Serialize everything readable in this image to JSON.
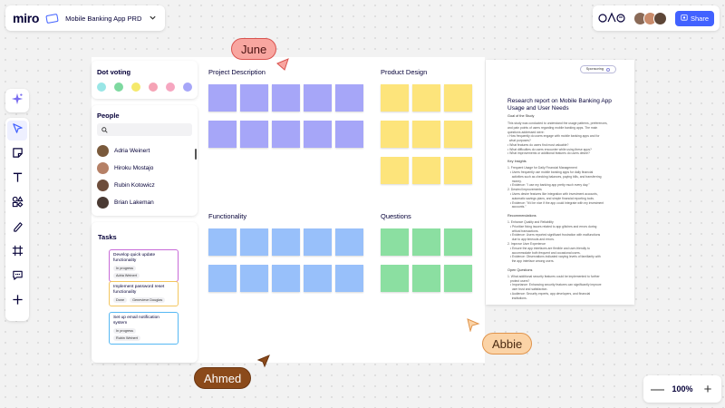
{
  "app": {
    "logo": "miro",
    "board_title": "Mobile Banking App PRD"
  },
  "header": {
    "reactions_label": "♪ ☺ ✈",
    "share_label": "Share",
    "avatar_colors": [
      "#8a6a57",
      "#c98b6b",
      "#5d4637"
    ]
  },
  "toolbar": {
    "tools": [
      "select-cursor",
      "sticky-note",
      "text",
      "shapes",
      "pen",
      "frame",
      "comment",
      "add-more"
    ]
  },
  "zoom": {
    "minus": "—",
    "level": "100%",
    "plus": "+"
  },
  "dot_voting": {
    "title": "Dot voting",
    "colors": [
      "#99e6e6",
      "#7ed9a0",
      "#f5e96b",
      "#f5a3b5",
      "#f6a6c0",
      "#a6a6f8"
    ]
  },
  "people": {
    "title": "People",
    "members": [
      {
        "name": "Adria Weinert",
        "color": "#7a5a3c"
      },
      {
        "name": "Hiroku Mostajo",
        "color": "#b58066"
      },
      {
        "name": "Rubin Kotowicz",
        "color": "#6d4d3b"
      },
      {
        "name": "Brian Lakeman",
        "color": "#4a3a33"
      }
    ]
  },
  "tasks": {
    "title": "Tasks",
    "items": [
      {
        "title": "Develop quick update functionality",
        "status": "In progress",
        "assignee": "Adria Weinert",
        "border": "#c86bd8"
      },
      {
        "title": "Implement password reset functionality",
        "status": "Done",
        "assignee": "Genevieve Douglas",
        "border": "#f3c65f"
      },
      {
        "title": "Set up email notification system",
        "status": "In progress",
        "assignee": "Rubin Weinert",
        "border": "#56b8f3"
      }
    ]
  },
  "frames": {
    "project_description": "Project Description",
    "product_design": "Product Design",
    "functionality": "Functionality",
    "questions": "Questions"
  },
  "document": {
    "tag": "Sponsoring",
    "title": "Research report on Mobile Banking App Usage and User Needs",
    "goal_heading": "Goal of the Study",
    "goal_lines": [
      "This study was conducted to understand the usage patterns, preferences,",
      "and pain points of users regarding mobile banking apps. The main",
      "questions addressed were:",
      "• How frequently do users engage with mobile banking apps and for",
      "  what purposes?",
      "• What features do users find most valuable?",
      "• What difficulties do users encounter while using these apps?",
      "• What improvements or additional features do users desire?"
    ],
    "insights_heading": "Key Insights",
    "insights_lines": [
      "1. Frequent Usage for Daily Financial Management",
      "   • Users frequently use mobile banking apps for daily financial",
      "     activities such as checking balances, paying bills, and transferring",
      "     money.",
      "   • Evidence: \"I use my banking app pretty much every day.\"",
      "2. Desired Improvements",
      "   • Users desire features like integration with investment accounts,",
      "     automatic savings plans, and simple financial reporting tools.",
      "   • Evidence: \"It'd be nice if the app could integrate with my investment",
      "     accounts.\""
    ],
    "recs_heading": "Recommendations",
    "recs_lines": [
      "1. Enhance Quality and Reliability",
      "   • Prioritize fixing issues related to app glitches and errors during",
      "     critical transactions.",
      "   • Evidence: Users reported significant frustration with malfunctions",
      "     due to app timeouts and errors.",
      "2. Improve User Experience",
      "   • Ensure the app interfaces are flexible and user-friendly to",
      "     accommodate both frequent and occasional users.",
      "   • Evidence: Observations indicated varying levels of familiarity with",
      "     the app interface among users."
    ],
    "open_heading": "Open Questions",
    "open_lines": [
      "1. What additional security features could be implemented to further",
      "   protect users?",
      "   • Importance: Enhancing security features can significantly improve",
      "     user trust and satisfaction.",
      "   • Audience: Security experts, app developers, and financial",
      "     institutions."
    ]
  },
  "cursors": {
    "june": {
      "name": "June",
      "bg": "#f8a6a0",
      "border": "#d9534f",
      "text": "#4a1111"
    },
    "abbie": {
      "name": "Abbie",
      "bg": "#fbd3a6",
      "border": "#e0944c",
      "text": "#4a2a11"
    },
    "ahmed": {
      "name": "Ahmed",
      "bg": "#8b4a1a",
      "border": "#6b3612",
      "text": "#ffffff"
    }
  }
}
